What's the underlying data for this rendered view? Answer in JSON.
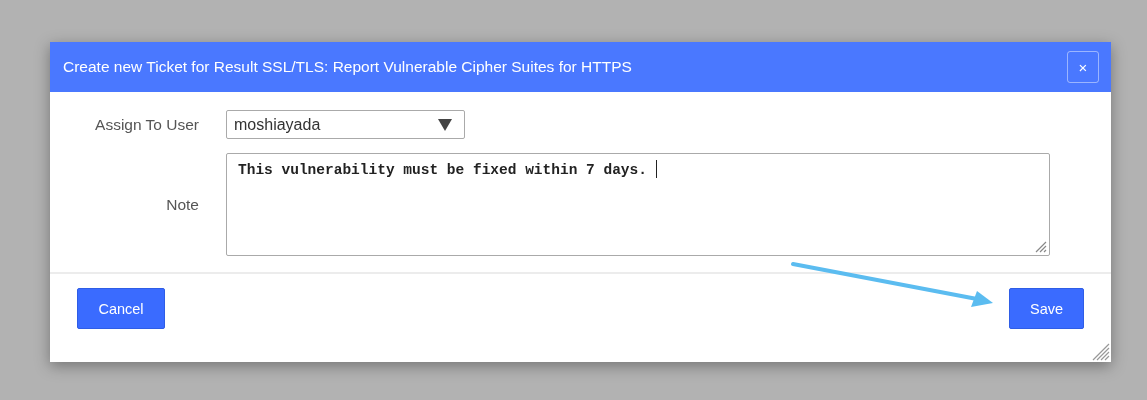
{
  "dialog": {
    "title": "Create new Ticket for Result SSL/TLS: Report Vulnerable Cipher Suites for HTTPS",
    "close_button": "×"
  },
  "fields": [
    {
      "kind": "select",
      "label": "Assign To User",
      "value": "moshiayada"
    },
    {
      "kind": "textarea",
      "label": "Note",
      "value": "This vulnerability must be fixed within 7 days. ",
      "focused": true
    }
  ],
  "buttons": [
    {
      "label": "Cancel",
      "kind": "cancel"
    },
    {
      "label": "Save",
      "kind": "save"
    }
  ]
}
